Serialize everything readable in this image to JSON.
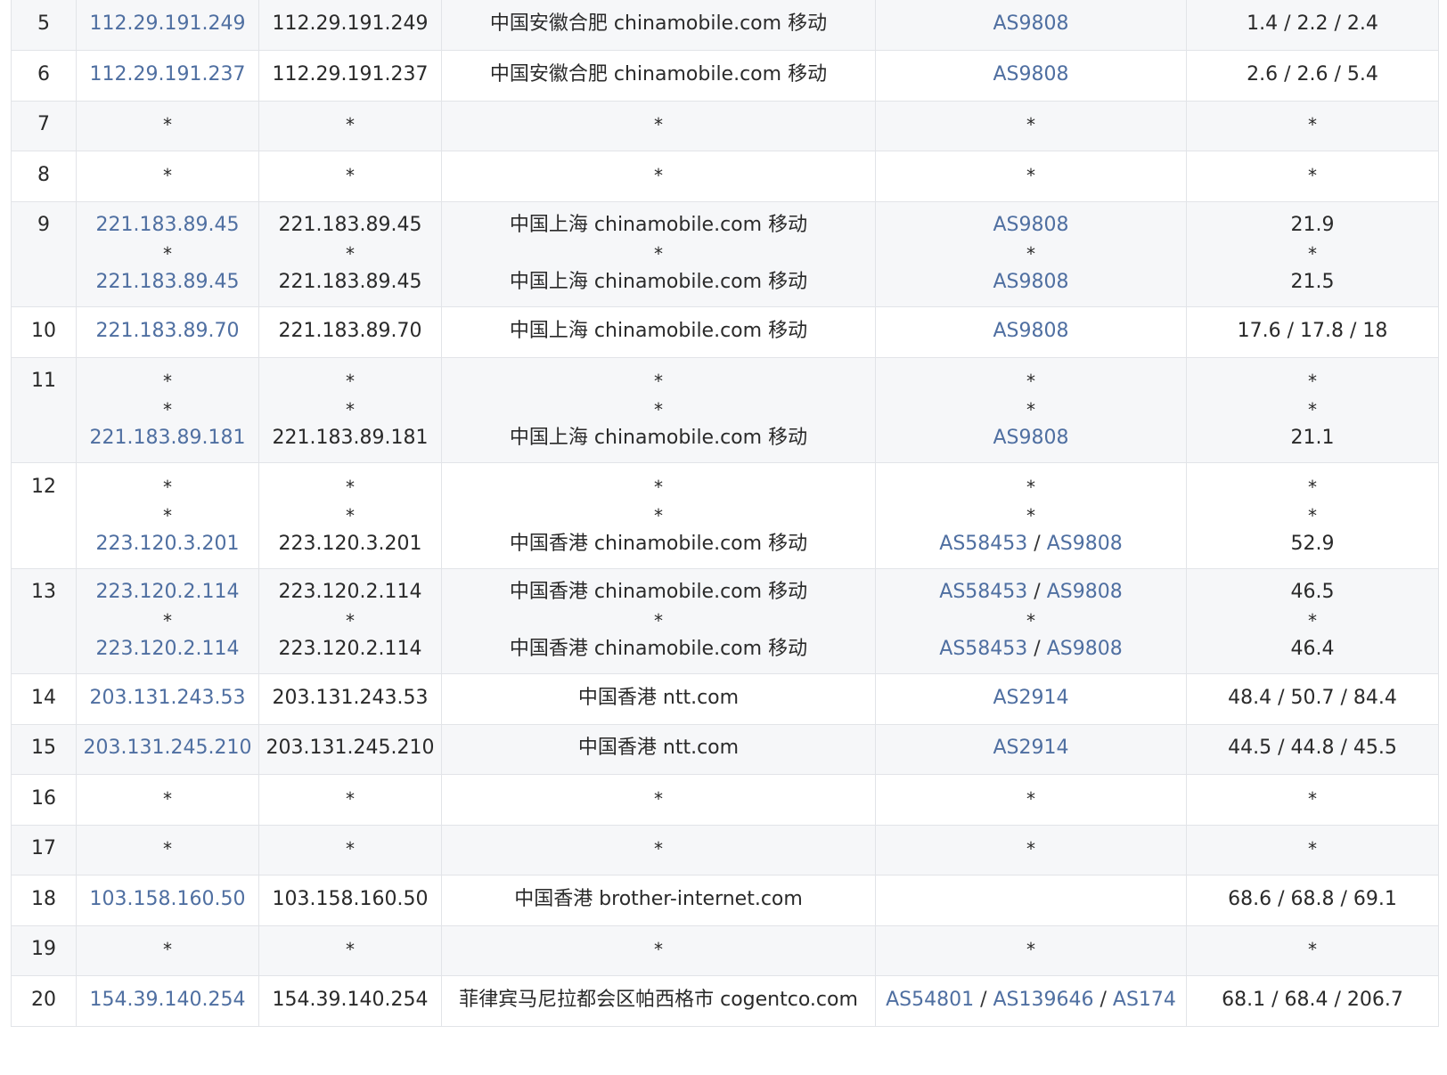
{
  "rows": [
    {
      "hop": "5",
      "lines": [
        {
          "ip": "112.29.191.249",
          "host": "112.29.191.249",
          "loc": "中国安徽合肥 chinamobile.com 移动",
          "as": [
            "AS9808"
          ],
          "rtt": "1.4 / 2.2 / 2.4"
        }
      ]
    },
    {
      "hop": "6",
      "lines": [
        {
          "ip": "112.29.191.237",
          "host": "112.29.191.237",
          "loc": "中国安徽合肥 chinamobile.com 移动",
          "as": [
            "AS9808"
          ],
          "rtt": "2.6 / 2.6 / 5.4"
        }
      ]
    },
    {
      "hop": "7",
      "lines": [
        {
          "ip": "*",
          "host": "*",
          "loc": "*",
          "as": [
            "*"
          ],
          "rtt": "*"
        }
      ]
    },
    {
      "hop": "8",
      "lines": [
        {
          "ip": "*",
          "host": "*",
          "loc": "*",
          "as": [
            "*"
          ],
          "rtt": "*"
        }
      ]
    },
    {
      "hop": "9",
      "lines": [
        {
          "ip": "221.183.89.45",
          "host": "221.183.89.45",
          "loc": "中国上海 chinamobile.com 移动",
          "as": [
            "AS9808"
          ],
          "rtt": "21.9"
        },
        {
          "ip": "*",
          "host": "*",
          "loc": "*",
          "as": [
            "*"
          ],
          "rtt": "*"
        },
        {
          "ip": "221.183.89.45",
          "host": "221.183.89.45",
          "loc": "中国上海 chinamobile.com 移动",
          "as": [
            "AS9808"
          ],
          "rtt": "21.5"
        }
      ]
    },
    {
      "hop": "10",
      "lines": [
        {
          "ip": "221.183.89.70",
          "host": "221.183.89.70",
          "loc": "中国上海 chinamobile.com 移动",
          "as": [
            "AS9808"
          ],
          "rtt": "17.6 / 17.8 / 18"
        }
      ]
    },
    {
      "hop": "11",
      "lines": [
        {
          "ip": "*",
          "host": "*",
          "loc": "*",
          "as": [
            "*"
          ],
          "rtt": "*"
        },
        {
          "ip": "*",
          "host": "*",
          "loc": "*",
          "as": [
            "*"
          ],
          "rtt": "*"
        },
        {
          "ip": "221.183.89.181",
          "host": "221.183.89.181",
          "loc": "中国上海 chinamobile.com 移动",
          "as": [
            "AS9808"
          ],
          "rtt": "21.1"
        }
      ]
    },
    {
      "hop": "12",
      "lines": [
        {
          "ip": "*",
          "host": "*",
          "loc": "*",
          "as": [
            "*"
          ],
          "rtt": "*"
        },
        {
          "ip": "*",
          "host": "*",
          "loc": "*",
          "as": [
            "*"
          ],
          "rtt": "*"
        },
        {
          "ip": "223.120.3.201",
          "host": "223.120.3.201",
          "loc": "中国香港 chinamobile.com 移动",
          "as": [
            "AS58453",
            "AS9808"
          ],
          "rtt": "52.9"
        }
      ]
    },
    {
      "hop": "13",
      "lines": [
        {
          "ip": "223.120.2.114",
          "host": "223.120.2.114",
          "loc": "中国香港 chinamobile.com 移动",
          "as": [
            "AS58453",
            "AS9808"
          ],
          "rtt": "46.5"
        },
        {
          "ip": "*",
          "host": "*",
          "loc": "*",
          "as": [
            "*"
          ],
          "rtt": "*"
        },
        {
          "ip": "223.120.2.114",
          "host": "223.120.2.114",
          "loc": "中国香港 chinamobile.com 移动",
          "as": [
            "AS58453",
            "AS9808"
          ],
          "rtt": "46.4"
        }
      ]
    },
    {
      "hop": "14",
      "lines": [
        {
          "ip": "203.131.243.53",
          "host": "203.131.243.53",
          "loc": "中国香港 ntt.com",
          "as": [
            "AS2914"
          ],
          "rtt": "48.4 / 50.7 / 84.4"
        }
      ]
    },
    {
      "hop": "15",
      "lines": [
        {
          "ip": "203.131.245.210",
          "host": "203.131.245.210",
          "loc": "中国香港 ntt.com",
          "as": [
            "AS2914"
          ],
          "rtt": "44.5 / 44.8 / 45.5"
        }
      ]
    },
    {
      "hop": "16",
      "lines": [
        {
          "ip": "*",
          "host": "*",
          "loc": "*",
          "as": [
            "*"
          ],
          "rtt": "*"
        }
      ]
    },
    {
      "hop": "17",
      "lines": [
        {
          "ip": "*",
          "host": "*",
          "loc": "*",
          "as": [
            "*"
          ],
          "rtt": "*"
        }
      ]
    },
    {
      "hop": "18",
      "lines": [
        {
          "ip": "103.158.160.50",
          "host": "103.158.160.50",
          "loc": "中国香港 brother-internet.com",
          "as": [],
          "rtt": "68.6 / 68.8 / 69.1"
        }
      ]
    },
    {
      "hop": "19",
      "lines": [
        {
          "ip": "*",
          "host": "*",
          "loc": "*",
          "as": [
            "*"
          ],
          "rtt": "*"
        }
      ]
    },
    {
      "hop": "20",
      "lines": [
        {
          "ip": "154.39.140.254",
          "host": "154.39.140.254",
          "loc": "菲律宾马尼拉都会区帕西格市 cogentco.com",
          "as": [
            "AS54801",
            "AS139646",
            "AS174"
          ],
          "rtt": "68.1 / 68.4 / 206.7"
        }
      ]
    }
  ],
  "colors": {
    "link": "#4f6fa1",
    "text": "#2a2a2a",
    "border": "#e2e4e8",
    "stripe": "#f6f7f9"
  }
}
